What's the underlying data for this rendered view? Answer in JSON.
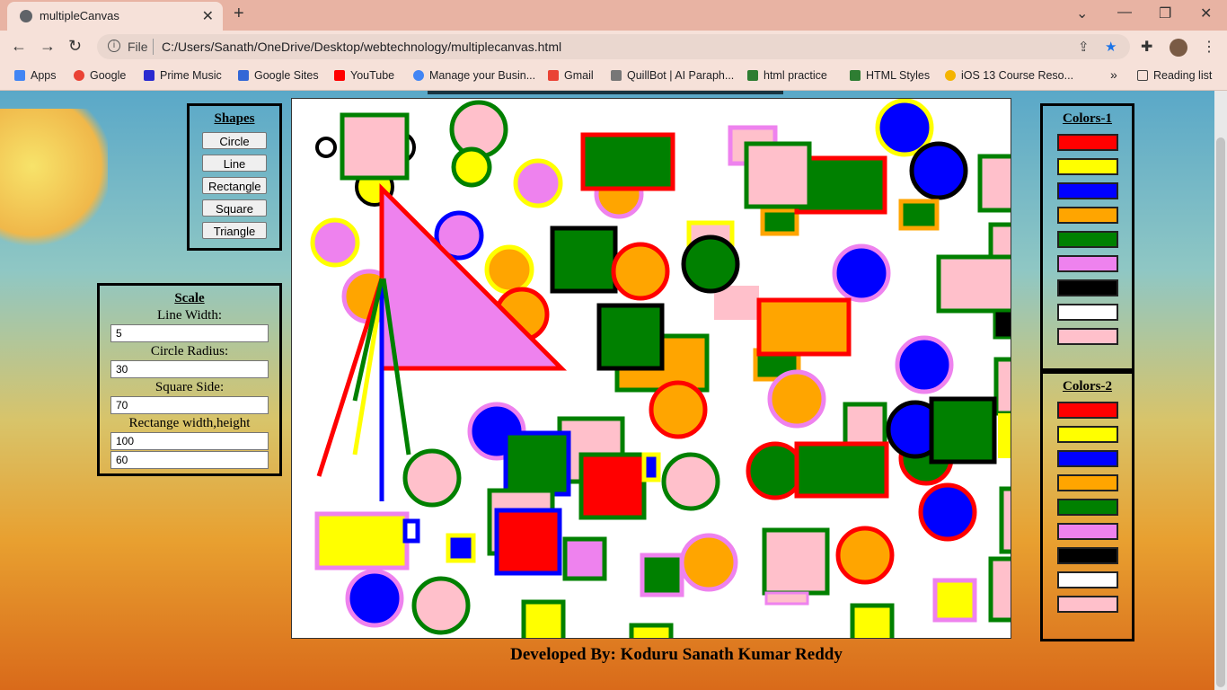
{
  "browser": {
    "tab_title": "multipleCanvas",
    "file_label": "File",
    "url": "C:/Users/Sanath/OneDrive/Desktop/webtechnology/multiplecanvas.html",
    "bookmarks": [
      {
        "label": "Apps",
        "color": "#4285f4"
      },
      {
        "label": "Google",
        "color": "#ea4335"
      },
      {
        "label": "Prime Music",
        "color": "#2a2ad0"
      },
      {
        "label": "Google Sites",
        "color": "#3367d6"
      },
      {
        "label": "YouTube",
        "color": "#ff0000"
      },
      {
        "label": "Manage your Busin...",
        "color": "#4285f4"
      },
      {
        "label": "Gmail",
        "color": "#ea4335"
      },
      {
        "label": "QuillBot | AI Paraph...",
        "color": "#777777"
      },
      {
        "label": "html practice",
        "color": "#2e7d32"
      },
      {
        "label": "HTML Styles",
        "color": "#2e7d32"
      },
      {
        "label": "iOS 13 Course Reso...",
        "color": "#f4b400"
      }
    ],
    "reading_list": "Reading list"
  },
  "shapes_panel": {
    "title": "Shapes",
    "buttons": [
      "Circle",
      "Line",
      "Rectangle",
      "Square",
      "Triangle"
    ]
  },
  "scale_panel": {
    "title": "Scale",
    "line_width_label": "Line Width:",
    "line_width": "5",
    "circle_radius_label": "Circle Radius:",
    "circle_radius": "30",
    "square_side_label": "Square Side:",
    "square_side": "70",
    "rect_label": "Rectange width,height",
    "rect_width": "100",
    "rect_height": "60"
  },
  "colors1": {
    "title": "Colors-1",
    "swatches": [
      "#ff0000",
      "#ffff00",
      "#0000ff",
      "#ffa500",
      "#008000",
      "#ee82ee",
      "#000000",
      "#ffffff",
      "#ffc0cb"
    ]
  },
  "colors2": {
    "title": "Colors-2",
    "swatches": [
      "#ff0000",
      "#ffff00",
      "#0000ff",
      "#ffa500",
      "#008000",
      "#ee82ee",
      "#000000",
      "#ffffff",
      "#ffc0cb"
    ]
  },
  "footer": "Developed By: Koduru Sanath Kumar Reddy"
}
